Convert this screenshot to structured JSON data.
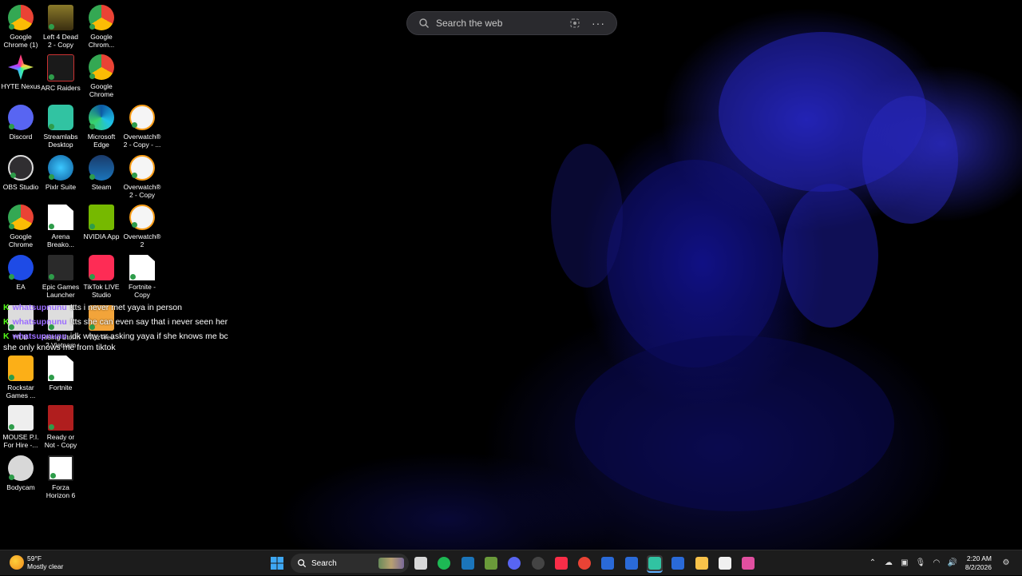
{
  "web_search": {
    "placeholder": "Search the web",
    "more": "···"
  },
  "desktop_icons": [
    {
      "label": "Google Chrome (1)",
      "icon": "chrome-icon"
    },
    {
      "label": "Left 4 Dead 2 - Copy",
      "icon": "left4dead-icon"
    },
    {
      "label": "Google Chrom...",
      "icon": "chrome-icon"
    },
    {
      "label": "HYTE Nexus",
      "icon": "hyte-nexus-icon"
    },
    {
      "label": "ARC Raiders",
      "icon": "arc-raiders-icon"
    },
    {
      "label": "Google Chrome",
      "icon": "chrome-icon"
    },
    {
      "label": "Discord",
      "icon": "discord-icon"
    },
    {
      "label": "Streamlabs Desktop",
      "icon": "streamlabs-icon"
    },
    {
      "label": "Microsoft Edge",
      "icon": "edge-icon"
    },
    {
      "label": "Overwatch® 2 - Copy - ...",
      "icon": "overwatch-icon"
    },
    {
      "label": "OBS Studio",
      "icon": "obs-icon"
    },
    {
      "label": "Pixlr Suite",
      "icon": "pixlr-icon"
    },
    {
      "label": "Steam",
      "icon": "steam-icon"
    },
    {
      "label": "Overwatch® 2 - Copy",
      "icon": "overwatch-icon"
    },
    {
      "label": "Google Chrome",
      "icon": "chrome-icon"
    },
    {
      "label": "Arena Breako...",
      "icon": "file-icon"
    },
    {
      "label": "NVIDIA App",
      "icon": "nvidia-icon"
    },
    {
      "label": "Overwatch® 2",
      "icon": "overwatch-icon"
    },
    {
      "label": "EA",
      "icon": "ea-icon"
    },
    {
      "label": "Epic Games Launcher",
      "icon": "epic-games-icon"
    },
    {
      "label": "TikTok LIVE Studio",
      "icon": "tiktok-icon"
    },
    {
      "label": "Fortnite - Copy",
      "icon": "file-icon"
    },
    {
      "label": "HUB",
      "icon": "hub-icon"
    },
    {
      "label": "Rising Storm 2 Vietnam",
      "icon": "rising-storm-icon"
    },
    {
      "label": "WizTree",
      "icon": "wiztree-icon"
    },
    {
      "label": "Rockstar Games ...",
      "icon": "rockstar-icon"
    },
    {
      "label": "Fortnite",
      "icon": "file-icon"
    },
    {
      "label": "MOUSE P.I. For Hire -...",
      "icon": "mouse-pi-icon"
    },
    {
      "label": "Ready or Not - Copy",
      "icon": "ready-or-not-icon"
    },
    {
      "label": "Bodycam",
      "icon": "bodycam-icon"
    },
    {
      "label": "Forza Horizon 6",
      "icon": "forza-icon"
    }
  ],
  "chat": [
    {
      "badge": "K",
      "user": "whatsupnunu",
      "text": "!tts i never met yaya in person"
    },
    {
      "badge": "K",
      "user": "whatsupnunu",
      "text": "!tts she can even say that i never seen her"
    },
    {
      "badge": "K",
      "user": "whatsupnunu",
      "text": "idk why ur asking yaya if she knows me bc she only knows me from tiktok"
    }
  ],
  "taskbar": {
    "weather_temp": "59°F",
    "weather_desc": "Mostly clear",
    "search_label": "Search",
    "pinned": [
      "task-view-icon",
      "spotify-icon",
      "steam-icon",
      "minecraft-icon",
      "discord-icon",
      "obs-icon",
      "apple-music-icon",
      "chrome-icon",
      "app-icon",
      "app-icon",
      "streamlabs-icon",
      "app-icon",
      "file-explorer-icon",
      "forza-icon",
      "hyte-nexus-icon"
    ],
    "time": "2:20 AM",
    "date": "8/2/2026"
  },
  "colors": {
    "accent": "#2020c8",
    "kick_green": "#53fc18",
    "username": "#9b6cff",
    "taskbar": "#1c1c1c"
  }
}
